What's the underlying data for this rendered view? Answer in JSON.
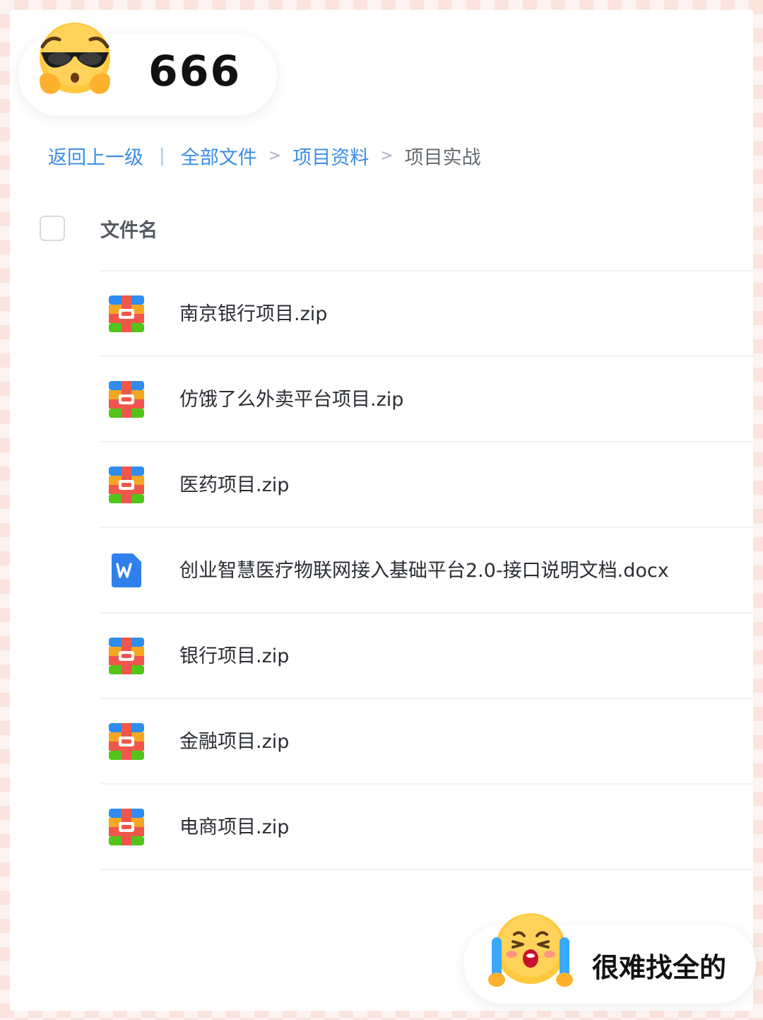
{
  "top_sticker": {
    "text": "666",
    "emoji": "cool-sunglasses-emoji"
  },
  "breadcrumb": {
    "back": "返回上一级",
    "separator": "|",
    "items": [
      {
        "label": "全部文件",
        "link": true
      },
      {
        "label": "项目资料",
        "link": true
      },
      {
        "label": "项目实战",
        "link": false
      }
    ],
    "chevron": ">"
  },
  "table": {
    "header": "文件名",
    "files": [
      {
        "name": "南京银行项目.zip",
        "type": "zip"
      },
      {
        "name": "仿饿了么外卖平台项目.zip",
        "type": "zip"
      },
      {
        "name": "医药项目.zip",
        "type": "zip"
      },
      {
        "name": "创业智慧医疗物联网接入基础平台2.0-接口说明文档.docx",
        "type": "docx"
      },
      {
        "name": "银行项目.zip",
        "type": "zip"
      },
      {
        "name": "金融项目.zip",
        "type": "zip"
      },
      {
        "name": "电商项目.zip",
        "type": "zip"
      }
    ]
  },
  "bottom_sticker": {
    "text": "很难找全的",
    "emoji": "crying-emoji"
  },
  "colors": {
    "link": "#3a8ee6",
    "zip_red": "#f0574b",
    "zip_orange": "#f5a623",
    "zip_green": "#52c41a",
    "zip_blue": "#2f8cf0",
    "docx_blue": "#2f80ed"
  }
}
